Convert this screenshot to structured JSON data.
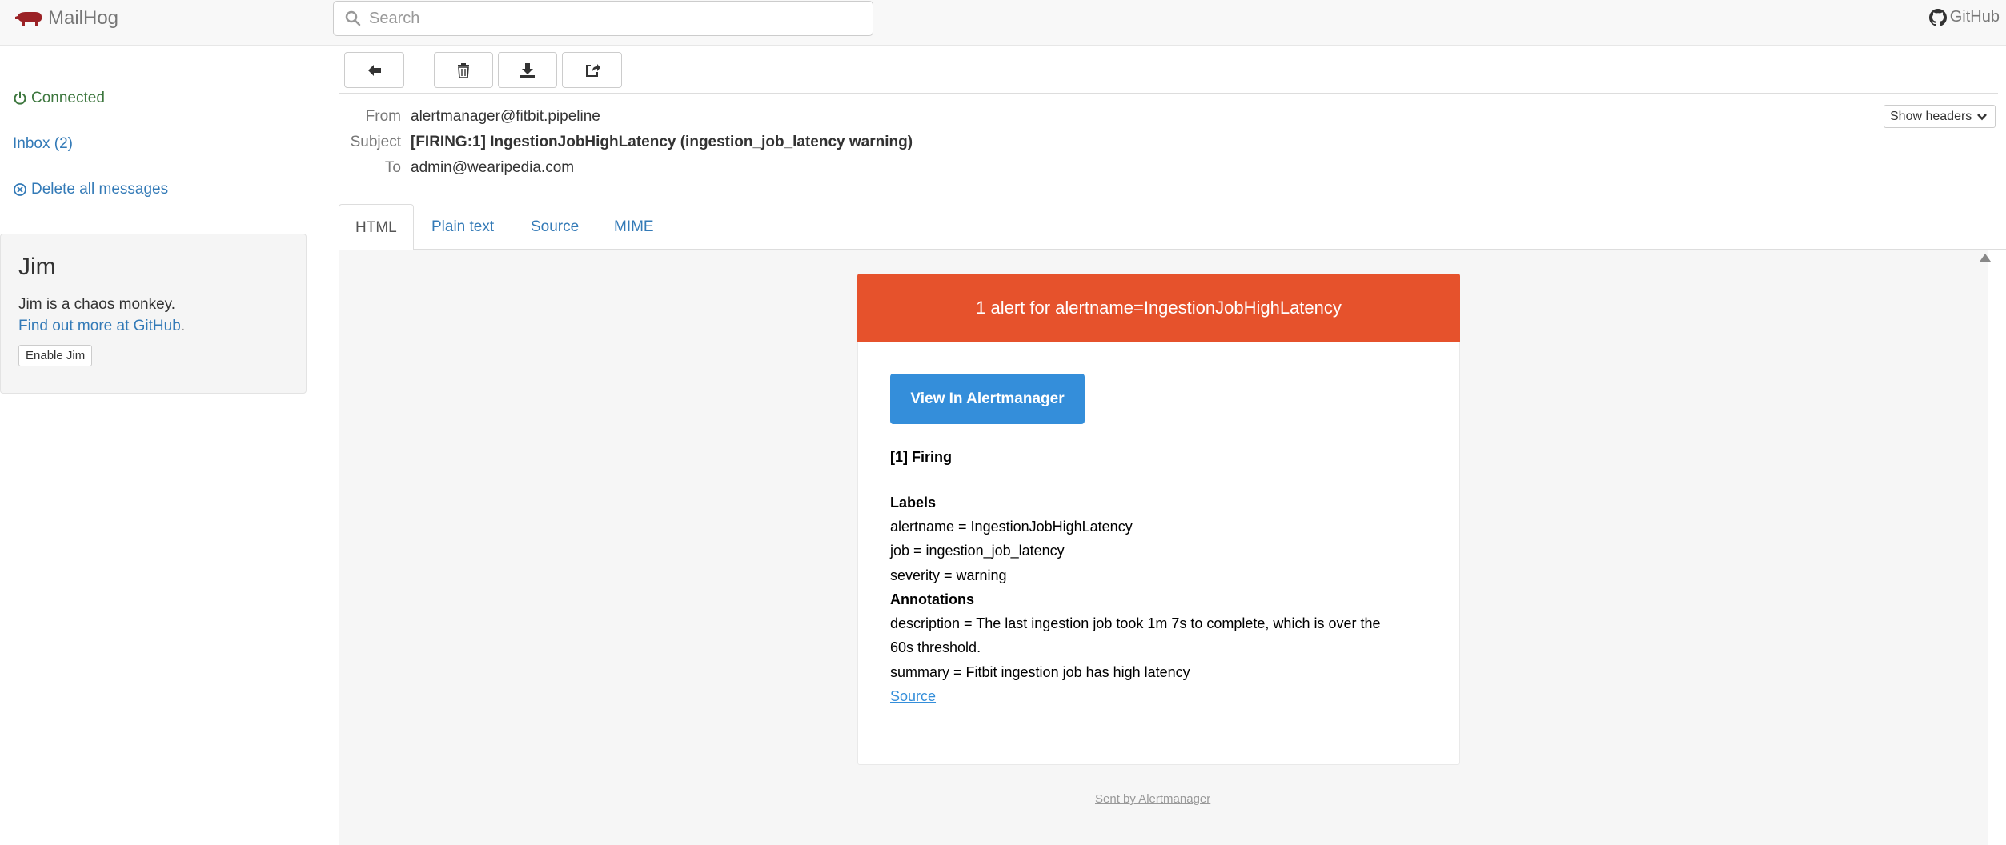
{
  "app": {
    "brand": "MailHog",
    "github_label": "GitHub"
  },
  "search": {
    "placeholder": "Search"
  },
  "sidebar": {
    "connected": "Connected",
    "inbox": "Inbox (2)",
    "delete_all": "Delete all messages"
  },
  "jim": {
    "title": "Jim",
    "description": "Jim is a chaos monkey.",
    "link": "Find out more at GitHub",
    "period": ".",
    "button": "Enable Jim"
  },
  "toolbar": {
    "back_icon": "arrow-left-icon",
    "delete_icon": "trash-icon",
    "download_icon": "download-icon",
    "release_icon": "share-icon"
  },
  "message": {
    "from_label": "From",
    "from": "alertmanager@fitbit.pipeline",
    "subject_label": "Subject",
    "subject": "[FIRING:1] IngestionJobHighLatency (ingestion_job_latency warning)",
    "to_label": "To",
    "to": "admin@wearipedia.com",
    "show_headers": "Show headers"
  },
  "tabs": [
    {
      "label": "HTML",
      "active": true
    },
    {
      "label": "Plain text",
      "active": false
    },
    {
      "label": "Source",
      "active": false
    },
    {
      "label": "MIME",
      "active": false
    }
  ],
  "email": {
    "header": "1 alert for alertname=IngestionJobHighLatency",
    "button": "View In Alertmanager",
    "firing": "[1] Firing",
    "labels_title": "Labels",
    "label_alertname": "alertname = IngestionJobHighLatency",
    "label_job": "job = ingestion_job_latency",
    "label_severity": "severity = warning",
    "annotations_title": "Annotations",
    "description_line1": "description = The last ingestion job took 1m 7s to complete, which is over the",
    "description_line2": "60s threshold.",
    "summary": "summary = Fitbit ingestion job has high latency",
    "source": "Source",
    "footer": "Sent by Alertmanager"
  },
  "colors": {
    "accent": "#337ab7",
    "connected": "#3c763d",
    "alert": "#e6522c",
    "button": "#348eda"
  }
}
